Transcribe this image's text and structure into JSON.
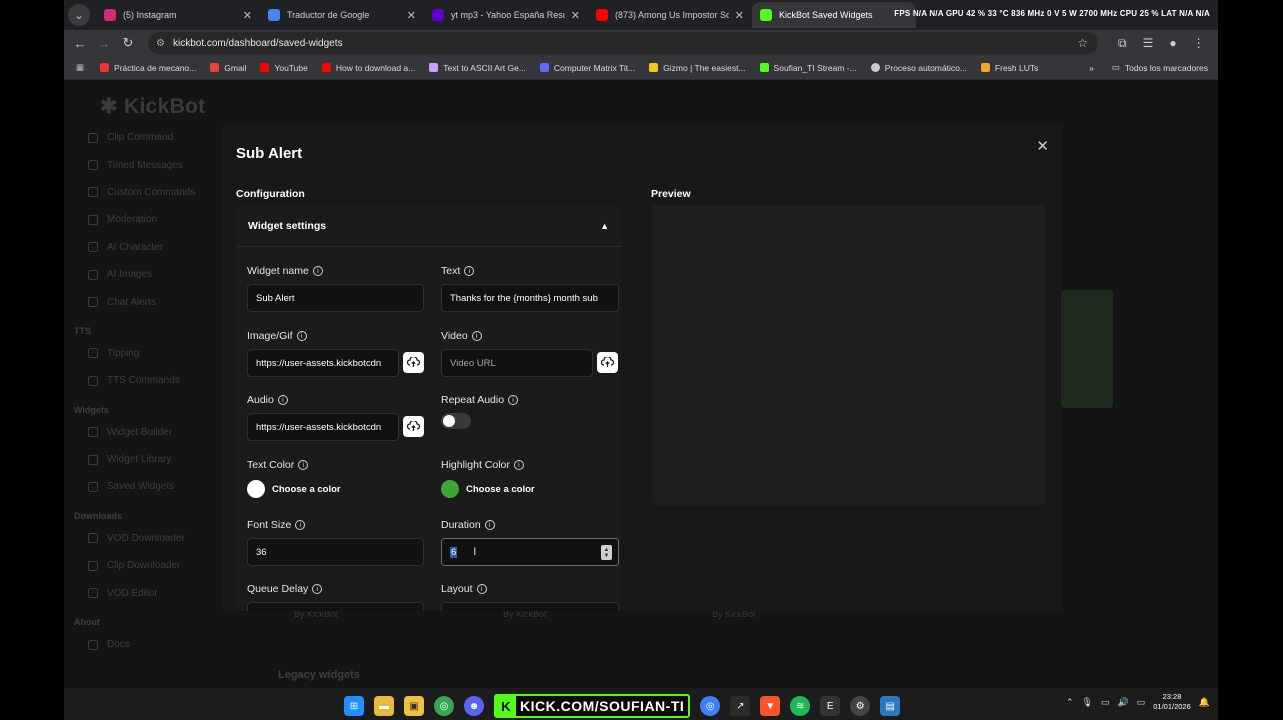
{
  "browser": {
    "tabs": [
      {
        "title": "(5) Instagram",
        "favcolor": "#d62976"
      },
      {
        "title": "Traductor de Google",
        "favcolor": "#4285f4"
      },
      {
        "title": "yt mp3 - Yahoo España Resultados",
        "favcolor": "#6001d2"
      },
      {
        "title": "(873) Among Us Impostor Sound",
        "favcolor": "#ff0000"
      },
      {
        "title": "KickBot Saved Widgets",
        "favcolor": "#53fc18"
      }
    ],
    "hud_text": "FPS N/A  N/A   GPU 42 % 33 °C 836 MHz  0 V  5 W 2700 MHz   CPU 25 %   LAT N/A  N/A",
    "url": "kickbot.com/dashboard/saved-widgets",
    "bookmarks": [
      {
        "label": "Práctica de mecano...",
        "color": "#e33"
      },
      {
        "label": "Gmail",
        "color": "#ea4335"
      },
      {
        "label": "YouTube",
        "color": "#ff0000"
      },
      {
        "label": "How to download a...",
        "color": "#ff0000"
      },
      {
        "label": "Text to ASCII Art Ge...",
        "color": "#c9a0ff"
      },
      {
        "label": "Computer Matrix Tit...",
        "color": "#5b6cff"
      },
      {
        "label": "Gizmo | The easiest...",
        "color": "#f5c518"
      },
      {
        "label": "Soufian_TI Stream -...",
        "color": "#53fc18"
      },
      {
        "label": "Proceso automático...",
        "color": "#cccccc"
      },
      {
        "label": "Fresh LUTs",
        "color": "#f5a623"
      }
    ],
    "all_bookmarks": "Todos los marcadores"
  },
  "app": {
    "logo": "KickBot",
    "sidebar": {
      "items_top": [
        "Clip Command",
        "Timed Messages",
        "Custom Commands",
        "Moderation",
        "AI Character",
        "AI Images",
        "Chat Alerts"
      ],
      "section_tts": "TTS",
      "items_tts": [
        "Tipping",
        "TTS Commands"
      ],
      "section_widgets": "Widgets",
      "items_widgets": [
        "Widget Builder",
        "Widget Library",
        "Saved Widgets"
      ],
      "section_downloads": "Downloads",
      "items_downloads": [
        "VOD Downloader",
        "Clip Downloader",
        "VOD Editor"
      ],
      "section_about": "About",
      "items_about": [
        "Docs"
      ]
    },
    "by_label": "By KickBot",
    "legacy_widgets": "Legacy widgets"
  },
  "modal": {
    "title": "Sub Alert",
    "configuration": "Configuration",
    "preview": "Preview",
    "widget_settings": "Widget settings",
    "fields": {
      "widget_name": {
        "label": "Widget name",
        "value": "Sub Alert"
      },
      "text": {
        "label": "Text",
        "value": "Thanks for the {months} month sub"
      },
      "image_gif": {
        "label": "Image/Gif",
        "value": "https://user-assets.kickbotcdn"
      },
      "video": {
        "label": "Video",
        "placeholder": "Video URL"
      },
      "audio": {
        "label": "Audio",
        "value": "https://user-assets.kickbotcdn"
      },
      "repeat_audio": {
        "label": "Repeat Audio",
        "on": false
      },
      "text_color": {
        "label": "Text Color",
        "choose": "Choose a color",
        "color": "#ffffff"
      },
      "highlight_color": {
        "label": "Highlight Color",
        "choose": "Choose a color",
        "color": "#3fa535"
      },
      "font_size": {
        "label": "Font Size",
        "value": "36"
      },
      "duration": {
        "label": "Duration",
        "value": "6"
      },
      "queue_delay": {
        "label": "Queue Delay"
      },
      "layout": {
        "label": "Layout"
      }
    }
  },
  "taskbar": {
    "kick_banner": "KICK.COM/SOUFIAN-TI",
    "time": "23:28",
    "date": "01/01/2026"
  }
}
